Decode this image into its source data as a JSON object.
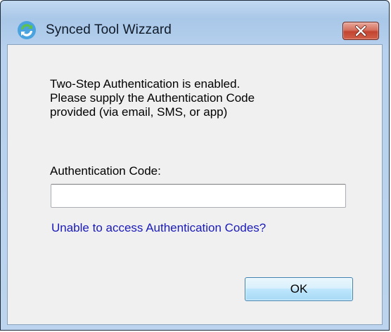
{
  "window": {
    "title": "Synced Tool Wizzard",
    "app_icon": "sync-arrows-icon",
    "close_icon": "close-x-icon",
    "close_color": "#c24430"
  },
  "dialog": {
    "message_line_1": "Two-Step Authentication is enabled.",
    "message_line_2": "Please supply the Authentication Code",
    "message_line_3": "provided (via email, SMS, or app)",
    "code_label": "Authentication Code:",
    "code_value": "",
    "help_link": "Unable to access Authentication Codes?",
    "link_color": "#1a1ab8",
    "ok_label": "OK"
  }
}
